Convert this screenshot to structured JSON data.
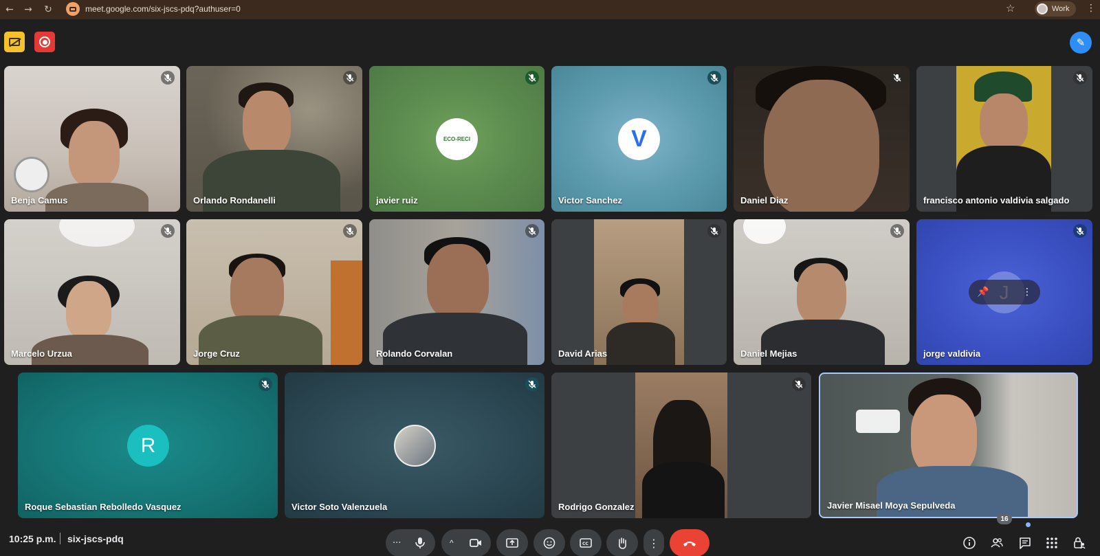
{
  "browser": {
    "url": "meet.google.com/six-jscs-pdq?authuser=0",
    "profile_label": "Work",
    "back_icon": "←",
    "forward_icon": "→",
    "reload_icon": "↻",
    "star_icon": "☆",
    "menu_icon": "⋮"
  },
  "meeting": {
    "time": "10:25 p.m.",
    "code": "six-jscs-pdq",
    "participant_count": "16",
    "pen_icon": "✎"
  },
  "participants": [
    {
      "name": "Benja Camus"
    },
    {
      "name": "Orlando Rondanelli"
    },
    {
      "name": "javier ruiz",
      "avatar_text": "ECO-RECI"
    },
    {
      "name": "Victor Sanchez",
      "avatar_text": "V"
    },
    {
      "name": "Daniel Diaz"
    },
    {
      "name": "francisco antonio valdivia salgado"
    },
    {
      "name": "Marcelo Urzua"
    },
    {
      "name": "Jorge Cruz"
    },
    {
      "name": "Rolando Corvalan"
    },
    {
      "name": "David Arias"
    },
    {
      "name": "Daniel Mejias"
    },
    {
      "name": "jorge valdivia",
      "avatar_text": "J"
    },
    {
      "name": "Roque Sebastian Rebolledo Vasquez",
      "avatar_text": "R"
    },
    {
      "name": "Victor Soto Valenzuela"
    },
    {
      "name": "Rodrigo Gonzalez"
    },
    {
      "name": "Javier Misael Moya Sepulveda"
    }
  ],
  "controls": {
    "more_dots": "···",
    "chevron_up": "^",
    "more_vertical": "⋮"
  },
  "colors": {
    "end_call": "#ea4335",
    "accent_blue": "#2e8ef5",
    "control_bg": "#3c4043",
    "page_bg": "#1f1f1f"
  }
}
